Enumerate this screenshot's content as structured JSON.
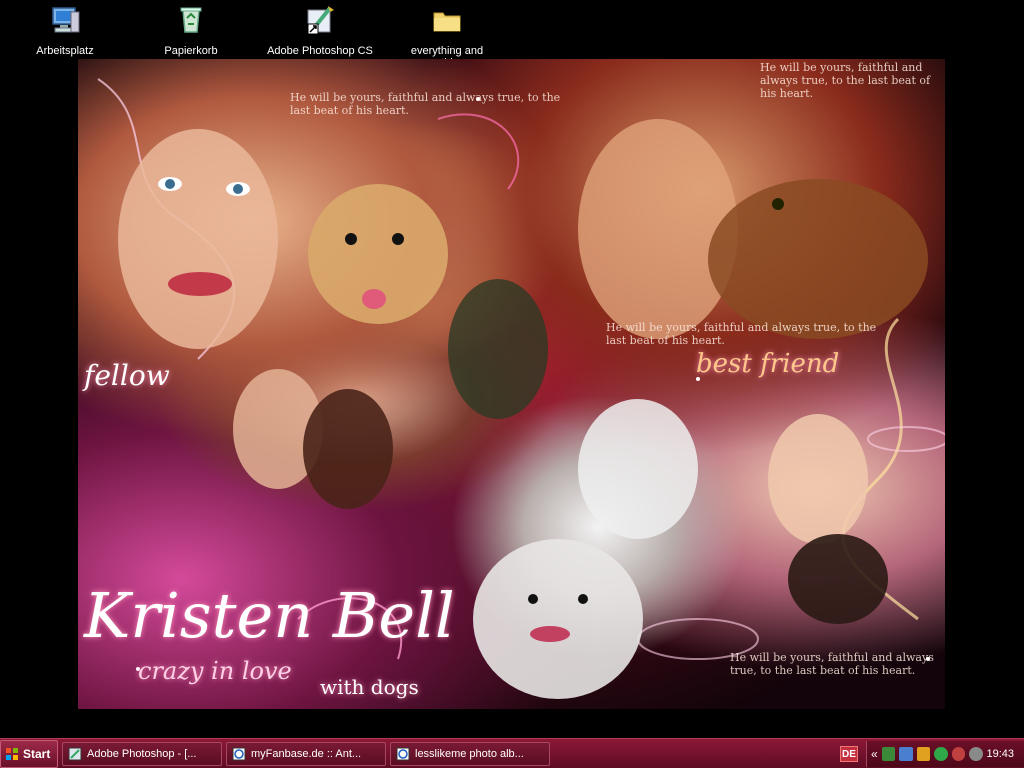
{
  "desktop": {
    "icons": [
      {
        "label": "Arbeitsplatz",
        "icon": "computer-icon"
      },
      {
        "label": "Papierkorb",
        "icon": "recycle-bin-icon"
      },
      {
        "label": "Adobe Photoshop CS",
        "icon": "photoshop-icon"
      },
      {
        "label": "everything and nothing",
        "icon": "folder-icon"
      }
    ]
  },
  "wallpaper": {
    "quote_top": "He will be yours, faithful and always true, to the last beat of his heart.",
    "quote_top_right": "He will be yours, faithful and always true, to the last beat of his heart.",
    "quote_mid": "He will be yours, faithful and always true, to the last beat of his heart.",
    "quote_bottom_right": "He will be yours, faithful and always true, to the last beat of his heart.",
    "fellow_text": "fellow",
    "best_friend_text": "best friend",
    "title": "Kristen Bell",
    "subtitle": "crazy in love",
    "subtitle2": "with dogs",
    "colors": {
      "accent": "#b31a3a",
      "pink": "#d44a9a",
      "dark": "#12040a"
    }
  },
  "taskbar": {
    "start_label": "Start",
    "tasks": [
      {
        "label": "Adobe Photoshop - [...",
        "icon": "photoshop-icon"
      },
      {
        "label": "myFanbase.de :: Ant...",
        "icon": "browser-icon"
      },
      {
        "label": "lesslikeme photo alb...",
        "icon": "browser-icon"
      }
    ],
    "language": "DE",
    "tray_chevron": "«",
    "clock": "19:43",
    "colors": {
      "bar": "#8c1836",
      "bar_dark": "#5e0c24"
    }
  }
}
